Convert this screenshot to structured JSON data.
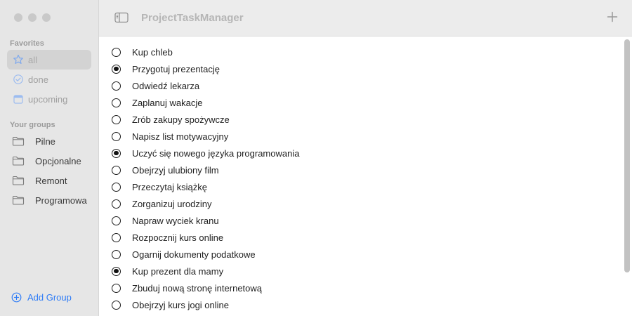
{
  "toolbar": {
    "title": "ProjectTaskManager"
  },
  "sidebar": {
    "favorites_title": "Favorites",
    "favorites": [
      {
        "label": "all",
        "icon": "star-icon",
        "active": true
      },
      {
        "label": "done",
        "icon": "checkmark-circle-icon",
        "active": false
      },
      {
        "label": "upcoming",
        "icon": "calendar-icon",
        "active": false
      }
    ],
    "groups_title": "Your groups",
    "groups": [
      {
        "label": "Pilne",
        "icon": "folder-icon"
      },
      {
        "label": "Opcjonalne",
        "icon": "folder-icon"
      },
      {
        "label": "Remont",
        "icon": "folder-icon"
      },
      {
        "label": "Programowa",
        "icon": "folder-icon"
      }
    ],
    "add_group_label": "Add Group"
  },
  "tasks": [
    {
      "label": "Kup chleb",
      "done": false
    },
    {
      "label": "Przygotuj prezentację",
      "done": true
    },
    {
      "label": "Odwiedź lekarza",
      "done": false
    },
    {
      "label": "Zaplanuj wakacje",
      "done": false
    },
    {
      "label": "Zrób zakupy spożywcze",
      "done": false
    },
    {
      "label": "Napisz list motywacyjny",
      "done": false
    },
    {
      "label": "Uczyć się nowego języka programowania",
      "done": true
    },
    {
      "label": "Obejrzyj ulubiony film",
      "done": false
    },
    {
      "label": "Przeczytaj książkę",
      "done": false
    },
    {
      "label": "Zorganizuj urodziny",
      "done": false
    },
    {
      "label": "Napraw wyciek kranu",
      "done": false
    },
    {
      "label": "Rozpocznij kurs online",
      "done": false
    },
    {
      "label": "Ogarnij dokumenty podatkowe",
      "done": false
    },
    {
      "label": "Kup prezent dla mamy",
      "done": true
    },
    {
      "label": "Zbuduj nową stronę internetową",
      "done": false
    },
    {
      "label": "Obejrzyj kurs jogi online",
      "done": false
    }
  ],
  "colors": {
    "accent": "#2f7cf6",
    "sidebar_bg": "#e6e6e6",
    "toolbar_bg": "#ececec"
  }
}
